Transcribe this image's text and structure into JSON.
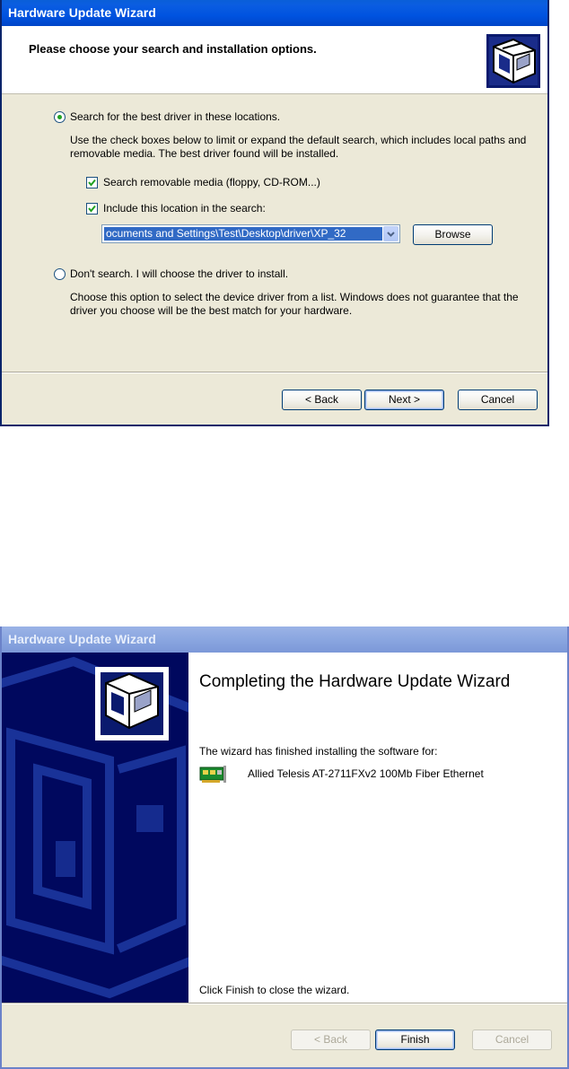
{
  "window1": {
    "title": "Hardware Update Wizard",
    "header_title": "Please choose your search and installation options.",
    "option_search_label": "Search for the best driver in these locations.",
    "option_search_desc": "Use the check boxes below to limit or expand the default search, which includes local paths and removable media. The best driver found will be installed.",
    "check_removable_label": "Search removable media (floppy, CD-ROM...)",
    "check_location_label": "Include this location in the search:",
    "location_value": "ocuments and Settings\\Test\\Desktop\\driver\\XP_32",
    "browse_label": "Browse",
    "option_dont_search_label": "Don't search. I will choose the driver to install.",
    "option_dont_search_desc": "Choose this option to select the device driver from a list.  Windows does not guarantee that the driver you choose will be the best match for your hardware.",
    "back_label": "< Back",
    "next_label": "Next >",
    "cancel_label": "Cancel"
  },
  "window2": {
    "title": "Hardware Update Wizard",
    "heading": "Completing the Hardware Update Wizard",
    "finished_text": "The wizard has finished installing the software for:",
    "device_name": "Allied Telesis AT-2711FXv2 100Mb Fiber Ethernet",
    "close_hint": "Click Finish to close the wizard.",
    "back_label": "< Back",
    "finish_label": "Finish",
    "cancel_label": "Cancel"
  }
}
